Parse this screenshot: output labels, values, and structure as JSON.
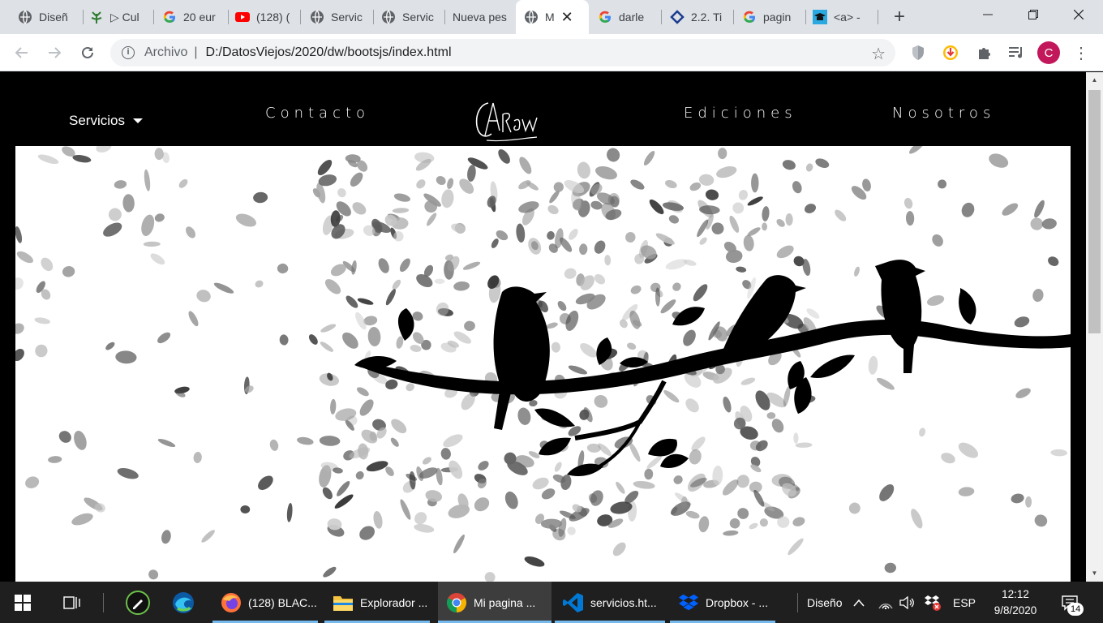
{
  "tabs": [
    {
      "title": "Diseñ",
      "icon": "globe-icon"
    },
    {
      "title": "▷ Cul",
      "icon": "plant-icon"
    },
    {
      "title": "20 eur",
      "icon": "google-icon"
    },
    {
      "title": "(128) (",
      "icon": "youtube-icon"
    },
    {
      "title": "Servic",
      "icon": "globe-icon"
    },
    {
      "title": "Servic",
      "icon": "globe-icon"
    },
    {
      "title": "Nueva pes",
      "icon": "none"
    },
    {
      "title": "M",
      "icon": "globe-icon",
      "active": true
    },
    {
      "title": "darle",
      "icon": "google-icon"
    },
    {
      "title": "2.2. Ti",
      "icon": "diamond-icon"
    },
    {
      "title": "pagin",
      "icon": "google-icon"
    },
    {
      "title": "<a> -",
      "icon": "mortarboard-icon"
    }
  ],
  "toolbar": {
    "scheme_label": "Archivo",
    "url": "D:/DatosViejos/2020/dw/bootsjs/index.html",
    "profile_letter": "C"
  },
  "site": {
    "menu": {
      "dropdown_label": "Servicios",
      "contacto": "Contacto",
      "ediciones": "Ediciones",
      "nosotros": "Nosotros"
    },
    "logo_text": "CAraw"
  },
  "taskbar": {
    "apps": [
      {
        "label": "(128) BLAC...",
        "icon": "firefox-icon"
      },
      {
        "label": "Explorador ...",
        "icon": "folder-icon"
      },
      {
        "label": "Mi pagina ...",
        "icon": "chrome-icon"
      },
      {
        "label": "servicios.ht...",
        "icon": "vscode-icon"
      },
      {
        "label": "Dropbox - ...",
        "icon": "dropbox-icon"
      }
    ],
    "tray_label": "Diseño",
    "language": "ESP",
    "time": "12:12",
    "date": "9/8/2020",
    "notification_count": "14"
  },
  "colors": {
    "tabstrip": "#dee1e6",
    "page_background": "#000000",
    "hero_background": "#ffffff",
    "taskbar": "#1f1f1f",
    "profile": "#c2185b"
  }
}
